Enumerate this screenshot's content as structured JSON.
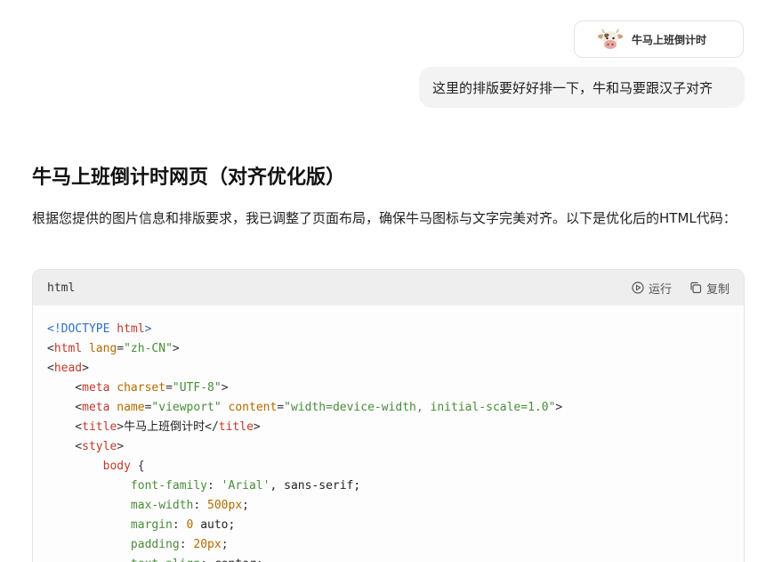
{
  "attachment": {
    "icon": "cow-face-icon",
    "filename": "牛马上班倒计时"
  },
  "user_message": "这里的排版要好好排一下，牛和马要跟汉子对齐",
  "response": {
    "title": "牛马上班倒计时网页（对齐优化版）",
    "description": "根据您提供的图片信息和排版要求，我已调整了页面布局，确保牛马图标与文字完美对齐。以下是优化后的HTML代码："
  },
  "code_block": {
    "language": "html",
    "run_label": "运行",
    "copy_label": "复制",
    "lines": [
      [
        {
          "t": "<!",
          "c": "tk-kw"
        },
        {
          "t": "DOCTYPE",
          "c": "tk-kw"
        },
        {
          "t": " html",
          "c": "tk-tag"
        },
        {
          "t": ">",
          "c": "tk-kw"
        }
      ],
      [
        {
          "t": "<",
          "c": "tk-punc"
        },
        {
          "t": "html",
          "c": "tk-tag"
        },
        {
          "t": " lang",
          "c": "tk-attr"
        },
        {
          "t": "=",
          "c": "tk-punc"
        },
        {
          "t": "\"zh-CN\"",
          "c": "tk-str"
        },
        {
          "t": ">",
          "c": "tk-punc"
        }
      ],
      [
        {
          "t": "<",
          "c": "tk-punc"
        },
        {
          "t": "head",
          "c": "tk-tag"
        },
        {
          "t": ">",
          "c": "tk-punc"
        }
      ],
      [
        {
          "t": "    <",
          "c": "tk-punc"
        },
        {
          "t": "meta",
          "c": "tk-tag"
        },
        {
          "t": " charset",
          "c": "tk-attr"
        },
        {
          "t": "=",
          "c": "tk-punc"
        },
        {
          "t": "\"UTF-8\"",
          "c": "tk-str"
        },
        {
          "t": ">",
          "c": "tk-punc"
        }
      ],
      [
        {
          "t": "    <",
          "c": "tk-punc"
        },
        {
          "t": "meta",
          "c": "tk-tag"
        },
        {
          "t": " name",
          "c": "tk-attr"
        },
        {
          "t": "=",
          "c": "tk-punc"
        },
        {
          "t": "\"viewport\"",
          "c": "tk-str"
        },
        {
          "t": " content",
          "c": "tk-attr"
        },
        {
          "t": "=",
          "c": "tk-punc"
        },
        {
          "t": "\"width=device-width, initial-scale=1.0\"",
          "c": "tk-str"
        },
        {
          "t": ">",
          "c": "tk-punc"
        }
      ],
      [
        {
          "t": "    <",
          "c": "tk-punc"
        },
        {
          "t": "title",
          "c": "tk-tag"
        },
        {
          "t": ">",
          "c": "tk-punc"
        },
        {
          "t": "牛马上班倒计时",
          "c": "tk-plain"
        },
        {
          "t": "</",
          "c": "tk-punc"
        },
        {
          "t": "title",
          "c": "tk-tag"
        },
        {
          "t": ">",
          "c": "tk-punc"
        }
      ],
      [
        {
          "t": "    <",
          "c": "tk-punc"
        },
        {
          "t": "style",
          "c": "tk-tag"
        },
        {
          "t": ">",
          "c": "tk-punc"
        }
      ],
      [
        {
          "t": "        body",
          "c": "tk-sel"
        },
        {
          "t": " {",
          "c": "tk-punc"
        }
      ],
      [
        {
          "t": "            font-family",
          "c": "tk-prop"
        },
        {
          "t": ": ",
          "c": "tk-punc"
        },
        {
          "t": "'Arial'",
          "c": "tk-str"
        },
        {
          "t": ", sans-serif;",
          "c": "tk-plain"
        }
      ],
      [
        {
          "t": "            max-width",
          "c": "tk-prop"
        },
        {
          "t": ": ",
          "c": "tk-punc"
        },
        {
          "t": "500px",
          "c": "tk-num"
        },
        {
          "t": ";",
          "c": "tk-punc"
        }
      ],
      [
        {
          "t": "            margin",
          "c": "tk-prop"
        },
        {
          "t": ": ",
          "c": "tk-punc"
        },
        {
          "t": "0",
          "c": "tk-num"
        },
        {
          "t": " auto;",
          "c": "tk-plain"
        }
      ],
      [
        {
          "t": "            padding",
          "c": "tk-prop"
        },
        {
          "t": ": ",
          "c": "tk-punc"
        },
        {
          "t": "20px",
          "c": "tk-num"
        },
        {
          "t": ";",
          "c": "tk-punc"
        }
      ],
      [
        {
          "t": "            text-align",
          "c": "tk-prop"
        },
        {
          "t": ": center;",
          "c": "tk-plain"
        }
      ]
    ]
  }
}
